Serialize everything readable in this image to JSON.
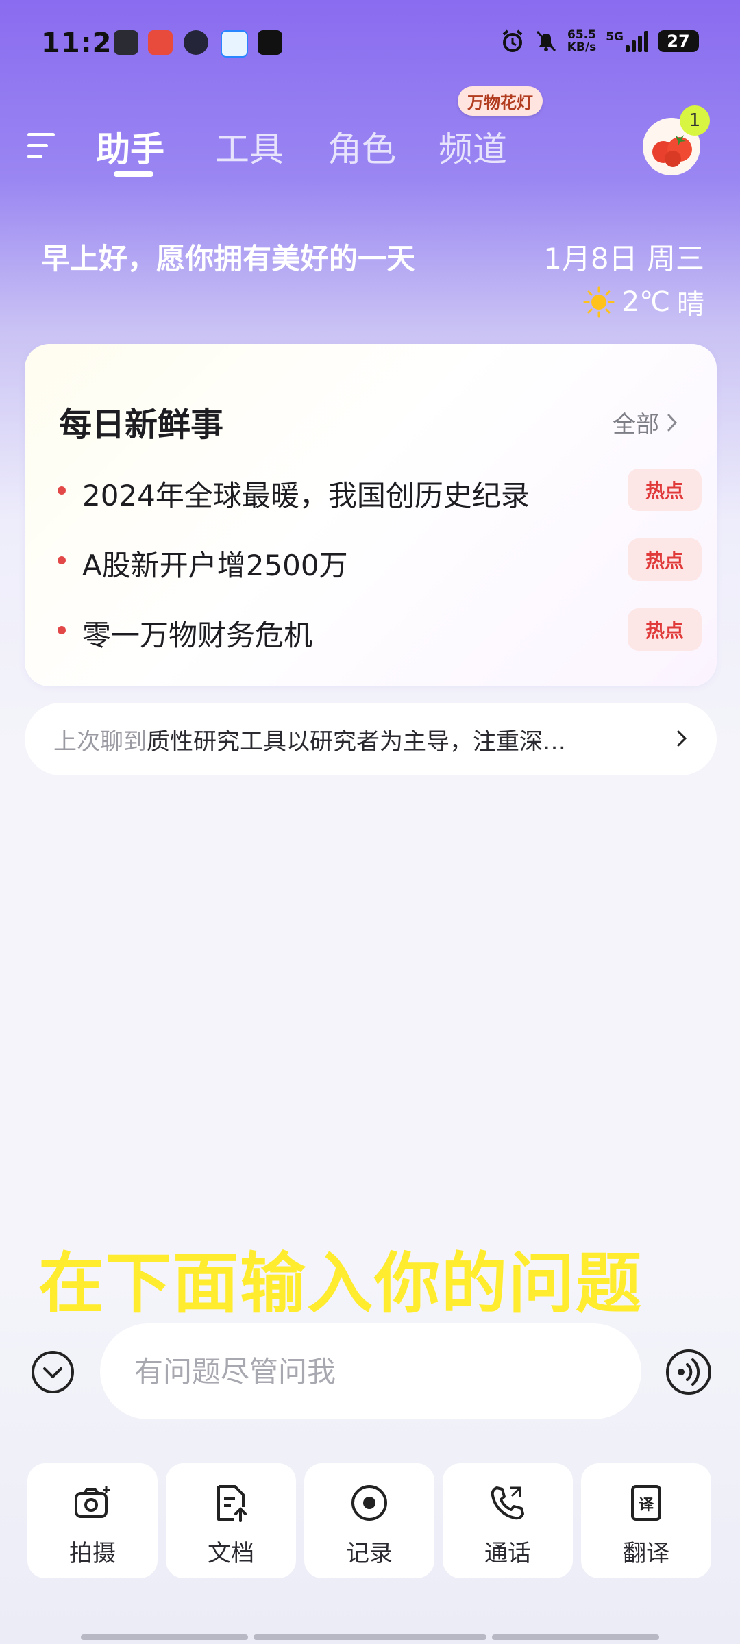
{
  "status_bar": {
    "time": "11:21",
    "net_speed_value": "65.5",
    "net_speed_unit": "KB/s",
    "network_type": "5G",
    "battery": "27"
  },
  "tabs": {
    "items": [
      {
        "label": "助手",
        "active": true
      },
      {
        "label": "工具",
        "active": false
      },
      {
        "label": "角色",
        "active": false
      },
      {
        "label": "频道",
        "active": false
      }
    ],
    "channel_badge": "万物花灯",
    "notification_count": "1"
  },
  "greeting": {
    "text": "早上好，愿你拥有美好的一天",
    "date": "1月8日 周三",
    "temperature": "2℃",
    "condition": "晴",
    "icon": "sun-icon"
  },
  "news": {
    "title": "每日新鲜事",
    "all_label": "全部",
    "items": [
      {
        "text": "2024年全球最暖，我国创历史纪录",
        "tag": "热点"
      },
      {
        "text": "A股新开户增2500万",
        "tag": "热点"
      },
      {
        "text": "零一万物财务危机",
        "tag": "热点"
      }
    ]
  },
  "last_chat": {
    "label": "上次聊到",
    "text": "质性研究工具以研究者为主导，注重深…"
  },
  "caption": "在下面输入你的问题",
  "input": {
    "placeholder": "有问题尽管问我"
  },
  "tools": [
    {
      "label": "拍摄",
      "icon": "camera-icon"
    },
    {
      "label": "文档",
      "icon": "document-upload-icon"
    },
    {
      "label": "记录",
      "icon": "record-icon"
    },
    {
      "label": "通话",
      "icon": "phone-call-icon"
    },
    {
      "label": "翻译",
      "icon": "translate-icon"
    }
  ],
  "colors": {
    "accent": "#8a6cf0",
    "hot_tag": "#e03a3a",
    "caption": "#ffec2e"
  }
}
